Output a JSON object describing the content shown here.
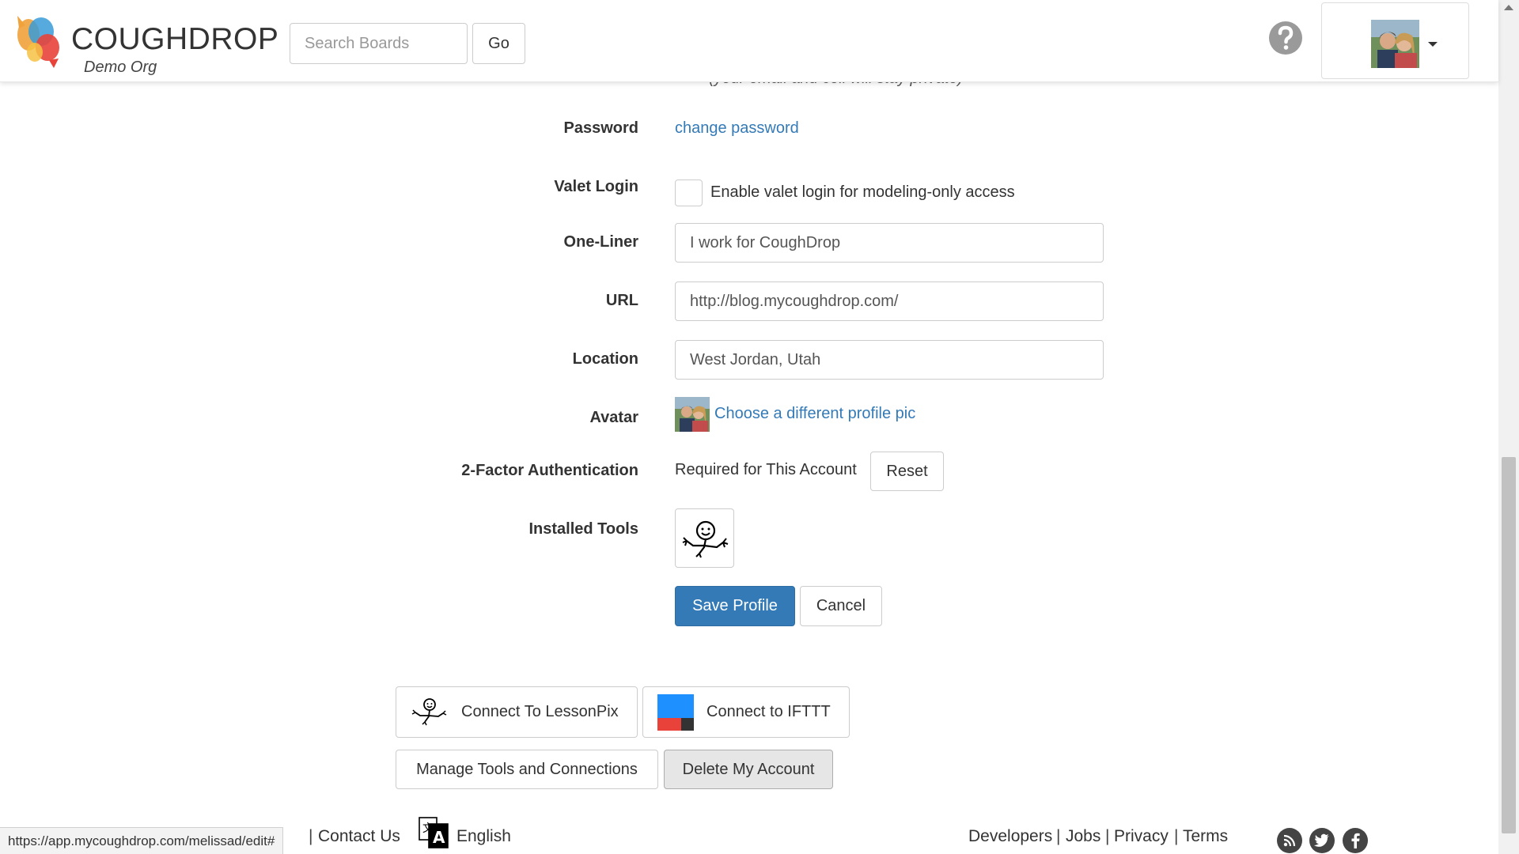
{
  "header": {
    "brand": "COUGHDROP",
    "org": "Demo Org",
    "search_placeholder": "Search Boards",
    "go_label": "Go"
  },
  "form": {
    "partial_hint": "(your email and cell will stay private)",
    "password": {
      "label": "Password",
      "link": "change password"
    },
    "valet": {
      "label": "Valet Login",
      "checkbox_label": "Enable valet login for modeling-only access"
    },
    "one_liner": {
      "label": "One-Liner",
      "value": "I work for CoughDrop"
    },
    "url": {
      "label": "URL",
      "value": "http://blog.mycoughdrop.com/"
    },
    "location": {
      "label": "Location",
      "value": "West Jordan, Utah"
    },
    "avatar": {
      "label": "Avatar",
      "link": "Choose a different profile pic"
    },
    "two_factor": {
      "label": "2-Factor Authentication",
      "status": "Required for This Account",
      "reset_label": "Reset"
    },
    "installed_tools": {
      "label": "Installed Tools"
    },
    "save_label": "Save Profile",
    "cancel_label": "Cancel"
  },
  "connections": {
    "lessonpix_label": "Connect To LessonPix",
    "ifttt_label": "Connect to IFTTT",
    "manage_label": "Manage Tools and Connections",
    "delete_label": "Delete My Account"
  },
  "footer": {
    "status_url": "https://app.mycoughdrop.com/melissad/edit#",
    "contact": "Contact Us",
    "language": "English",
    "developers": "Developers",
    "jobs": "Jobs",
    "privacy": "Privacy",
    "terms": "Terms",
    "sep": "|"
  },
  "colors": {
    "link": "#337ab7",
    "primary": "#337ab7",
    "ifttt_blue": "#1e90ff",
    "ifttt_red": "#e8423b"
  }
}
